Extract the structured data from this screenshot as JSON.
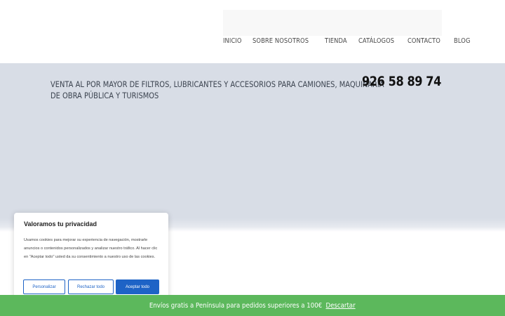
{
  "header": {
    "nav": [
      {
        "label": "INICIO"
      },
      {
        "label": "SOBRE NOSOTROS"
      },
      {
        "label": "TIENDA"
      },
      {
        "label": "CATÁLOGOS"
      },
      {
        "label": "CONTACTO"
      },
      {
        "label": "BLOG"
      }
    ]
  },
  "hero": {
    "tagline_line1": "VENTA AL POR MAYOR DE FILTROS, LUBRICANTES Y ACCESORIOS PARA CAMIONES, MAQUINARIA",
    "tagline_line2": "DE OBRA PÚBLICA Y TURISMOS",
    "phone": "926 58 89 74",
    "background_color": "#d8dde6"
  },
  "cookie_banner": {
    "title": "Valoramos tu privacidad",
    "text": "Usamos cookies para mejorar su experiencia de navegación, mostrarle anuncios o contenidos personalizados y analizar nuestro tráfico. Al hacer clic en \"Aceptar todo\" usted da su consentimiento a nuestro uso de las cookies.",
    "customize_label": "Personalizar",
    "reject_label": "Rechazar todo",
    "accept_label": "Aceptar todo",
    "accent_color": "#1e63c6"
  },
  "store_notice": {
    "text": "Envíos gratis a Península para pedidos superiores a 100€",
    "dismiss_label": "Descartar",
    "background_color": "#5cb85c"
  }
}
